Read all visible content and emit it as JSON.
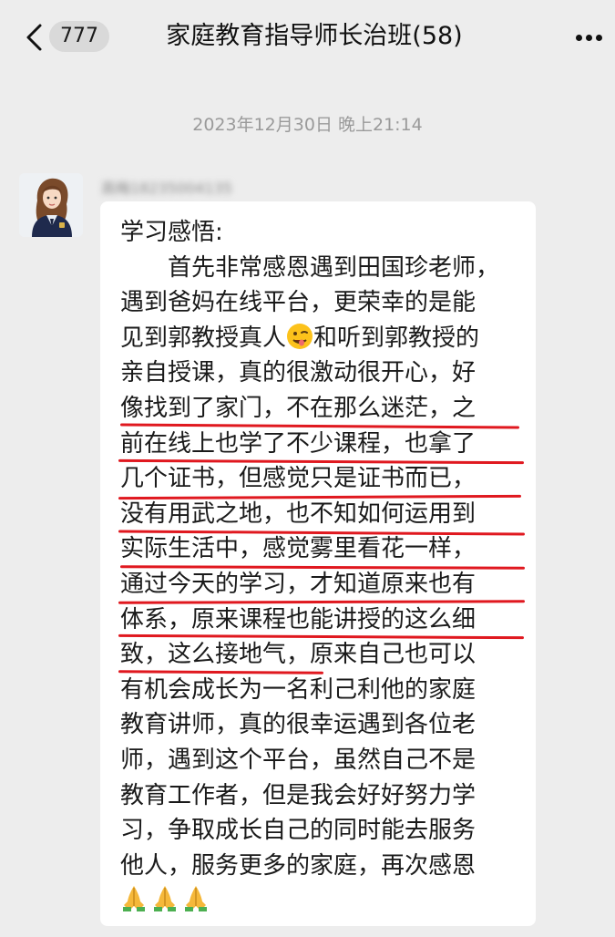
{
  "header": {
    "unread_count": "777",
    "title": "家庭教育指导师长治班(58)"
  },
  "timestamp": "2023年12月30日 晚上21:14",
  "message": {
    "sender_name": "高梅18235004135",
    "lines": [
      "学习感悟:",
      "　　首先非常感恩遇到田国珍老师，",
      "遇到爸妈在线平台，更荣幸的是能",
      "见到郭教授真人",
      "和听到郭教授的",
      "亲自授课，真的很激动很开心，好",
      "像找到了家门，不在那么迷茫，之",
      "前在线上也学了不少课程，也拿了",
      "几个证书，但感觉只是证书而已，",
      "没有用武之地，也不知如何运用到",
      "实际生活中，感觉雾里看花一样，",
      "通过今天的学习，才知道原来也有",
      "体系，原来课程也能讲授的这么细",
      "致，这么接地气，原来自己也可以",
      "有机会成长为一名利己利他的家庭",
      "教育讲师，真的很幸运遇到各位老",
      "师，遇到这个平台，虽然自己不是",
      "教育工作者，但是我会好好努力学",
      "习，争取成长自己的同时能去服务",
      "他人，服务更多的家庭，再次感恩"
    ],
    "inline_emoji": "winking-face-tongue-icon",
    "trailing_emojis": [
      "praying-hands-icon",
      "praying-hands-icon",
      "praying-hands-icon"
    ],
    "highlight_color": "#e0181f"
  },
  "colors": {
    "background": "#ededed",
    "bubble": "#ffffff",
    "badge": "#d9d9d9"
  }
}
